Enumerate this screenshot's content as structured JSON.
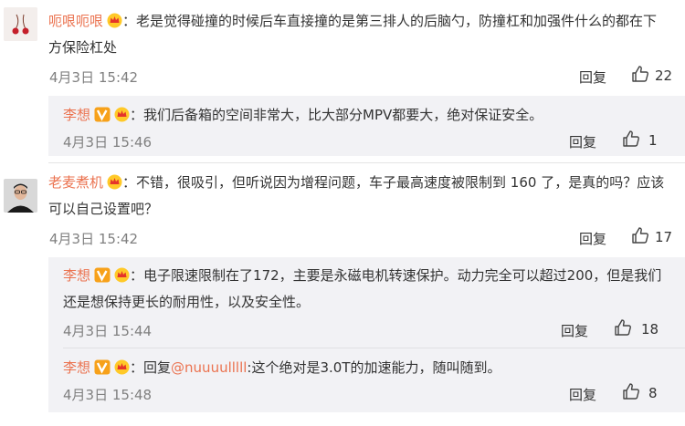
{
  "comments": [
    {
      "user": "呃哏呃哏",
      "text": "老是觉得碰撞的时候后车直接撞的是第三排人的后脑勺，防撞杠和加强件什么的都在下方保险杠处",
      "time": "4月3日 15:42",
      "reply_label": "回复",
      "likes": "22"
    },
    {
      "user": "老麦煮机",
      "text": "不错，很吸引，但听说因为增程问题，车子最高速度被限制到 160 了，是真的吗？应该可以自己设置吧？",
      "time": "4月3日 15:42",
      "reply_label": "回复",
      "likes": "17"
    }
  ],
  "replies": [
    {
      "user": "李想",
      "text": "我们后备箱的空间非常大，比大部分MPV都要大，绝对保证安全。",
      "time": "4月3日 15:46",
      "reply_label": "回复",
      "likes": "1"
    },
    {
      "user": "李想",
      "text": "电子限速限制在了172，主要是永磁电机转速保护。动力完全可以超过200，但是我们还是想保持更长的耐用性，以及安全性。",
      "time": "4月3日 15:44",
      "reply_label": "回复",
      "likes": "18"
    },
    {
      "user": "李想",
      "prefix": "回复",
      "mention": "@nuuuulllll",
      "text": ":这个绝对是3.0T的加速能力，随叫随到。",
      "time": "4月3日 15:48",
      "reply_label": "回复",
      "likes": "8"
    }
  ],
  "colors": {
    "username": "#eb7350",
    "reply_bg": "#f2f2f5",
    "meta": "#808080"
  },
  "icons": [
    "like-icon",
    "verified-v-icon",
    "vip-crown-icon"
  ]
}
